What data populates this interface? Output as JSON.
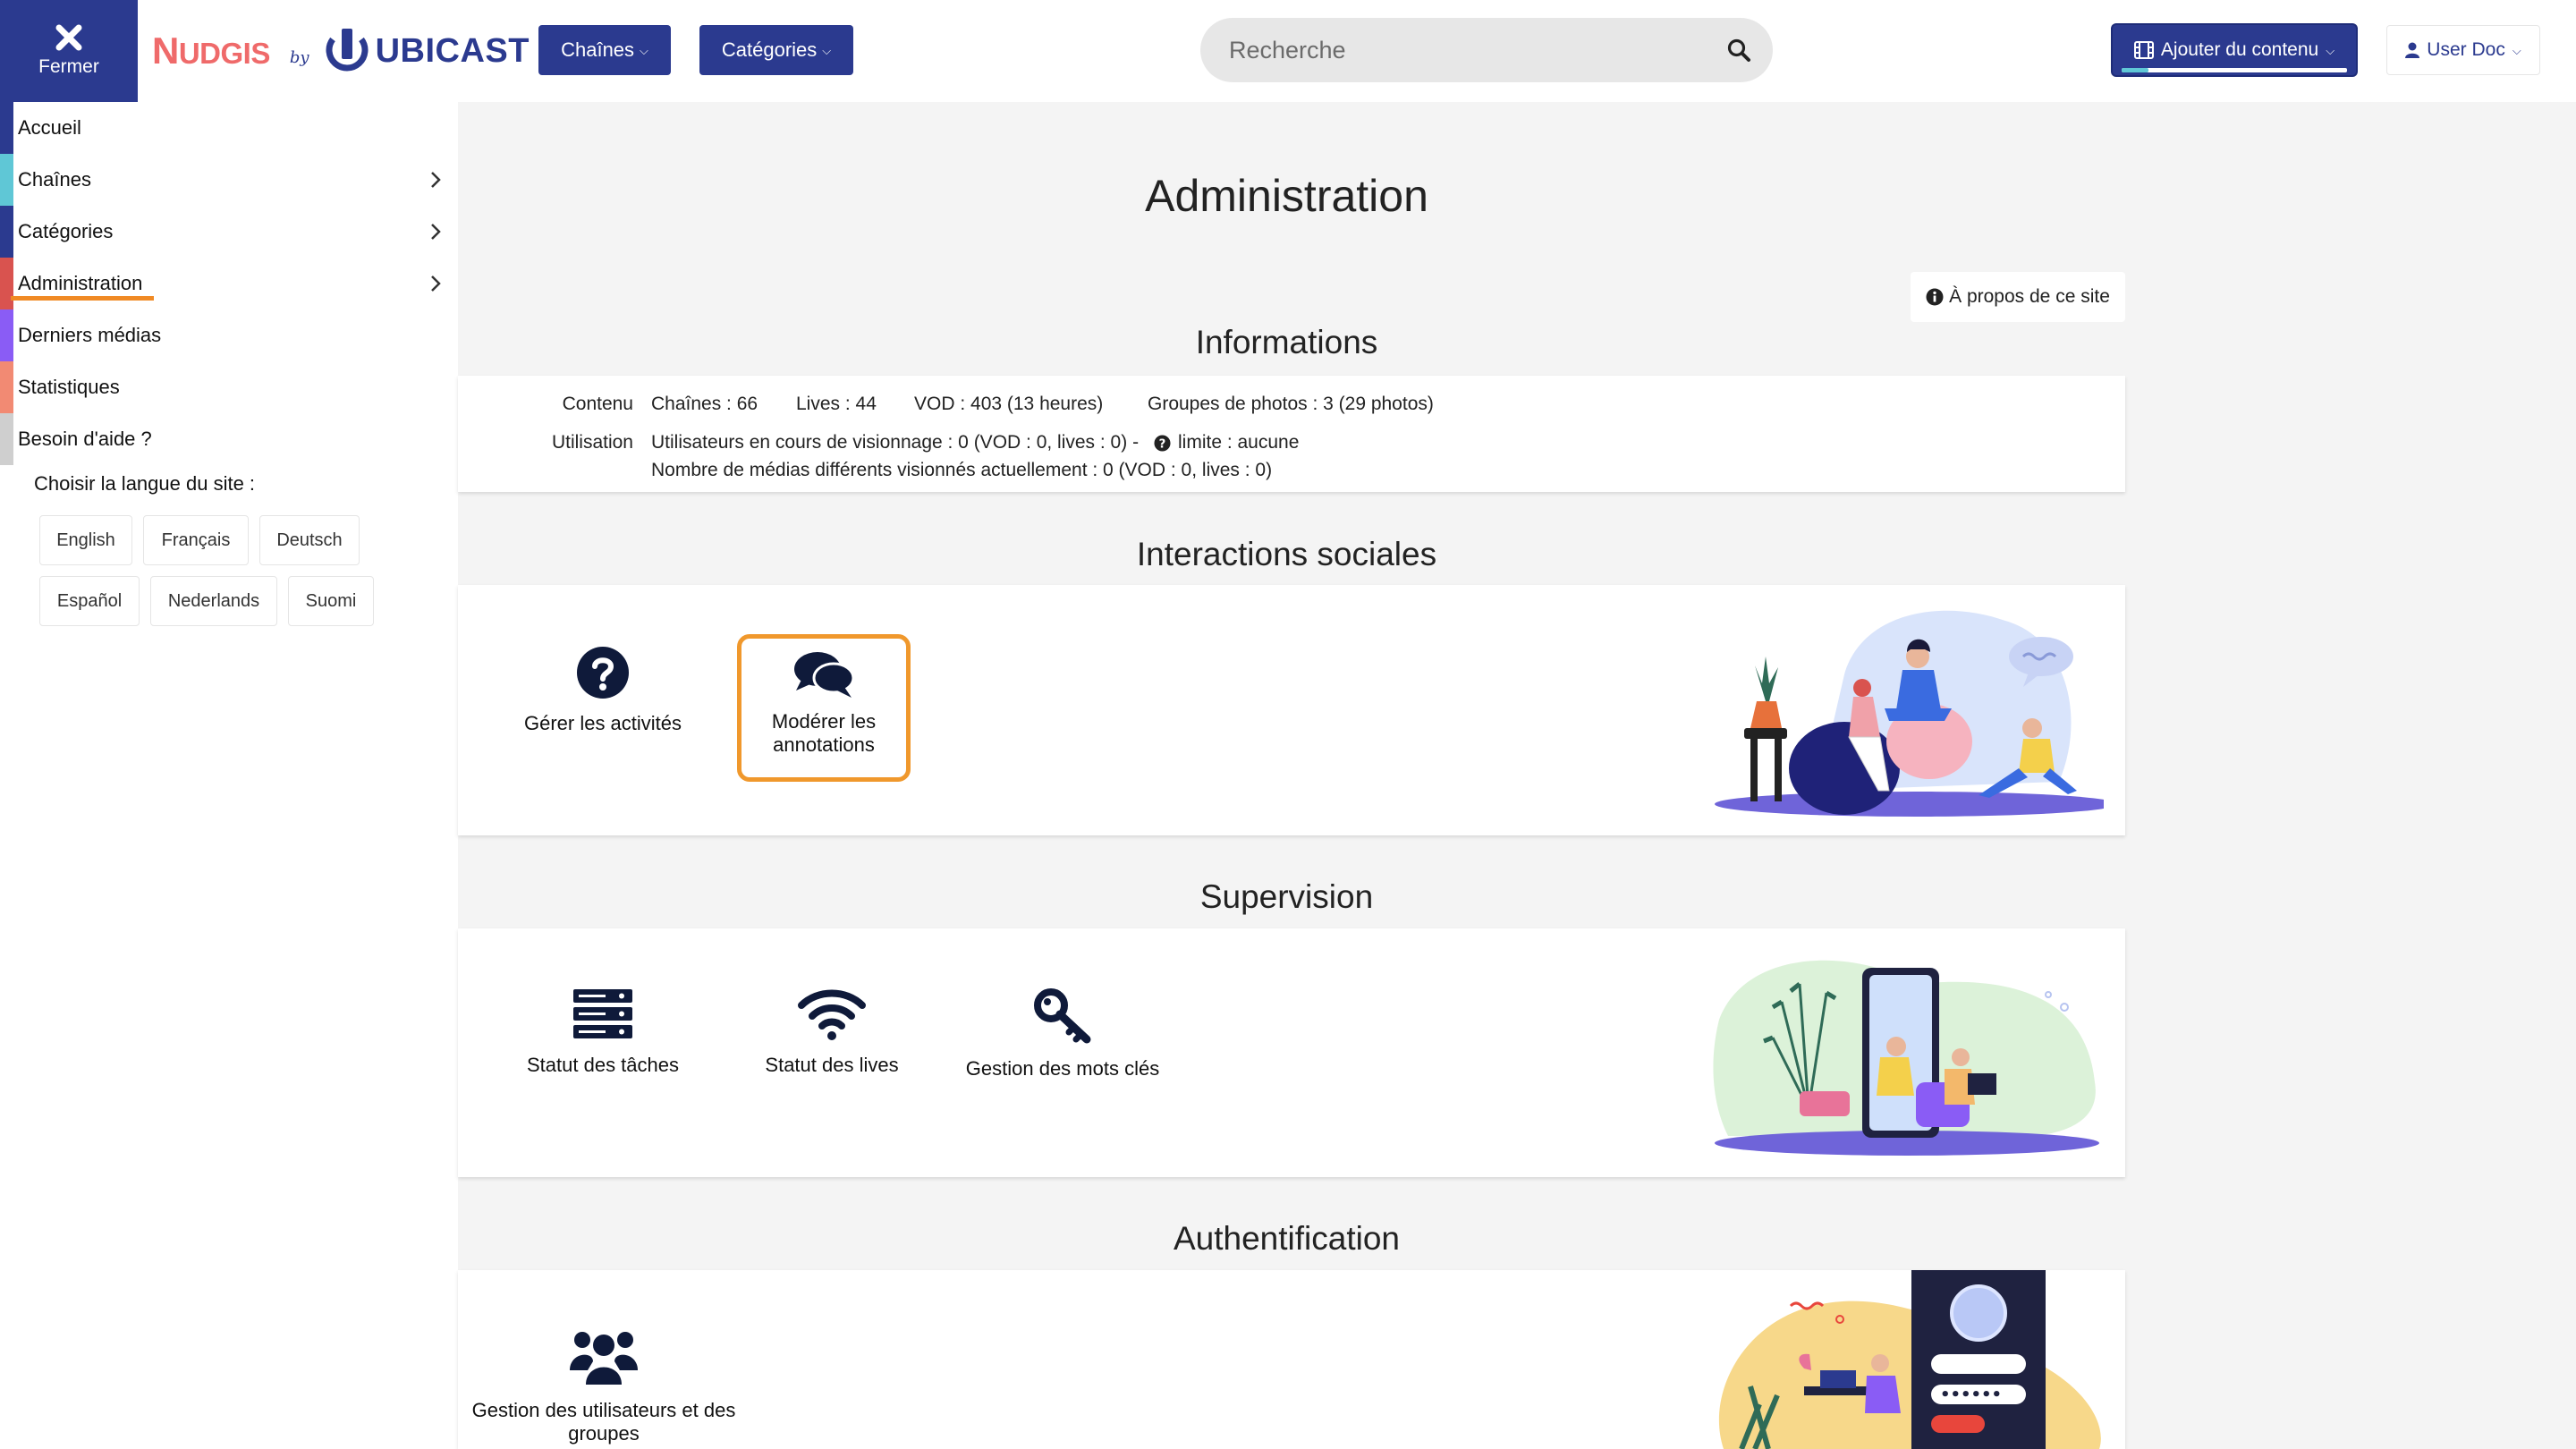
{
  "header": {
    "close_label": "Fermer",
    "logo": {
      "brand": "Nudgis",
      "by": "by",
      "partner": "UBICAST"
    },
    "nav": {
      "channels_label": "Chaînes",
      "categories_label": "Catégories"
    },
    "search": {
      "placeholder": "Recherche"
    },
    "add_content_label": "Ajouter du contenu",
    "user_label": "User Doc"
  },
  "sidebar": {
    "items": [
      {
        "label": "Accueil",
        "color": "#2b3a8f"
      },
      {
        "label": "Chaînes",
        "color": "#5fc7d6"
      },
      {
        "label": "Catégories",
        "color": "#2b3a8f"
      },
      {
        "label": "Administration",
        "color": "#d9534f"
      },
      {
        "label": "Derniers médias",
        "color": "#8a5cf5"
      },
      {
        "label": "Statistiques",
        "color": "#f28a73"
      },
      {
        "label": "Besoin d'aide ?",
        "color": "#cfcfcf"
      }
    ],
    "language_title": "Choisir la langue du site :",
    "languages": [
      "English",
      "Français",
      "Deutsch",
      "Español",
      "Nederlands",
      "Suomi"
    ]
  },
  "main": {
    "title": "Administration",
    "about_label": "À propos de ce site",
    "informations": {
      "title": "Informations",
      "content_label": "Contenu",
      "channels": "Chaînes : 66",
      "lives": "Lives : 44",
      "vod": "VOD : 403 (13 heures)",
      "photos": "Groupes de photos : 3 (29 photos)",
      "usage_label": "Utilisation",
      "usage_line1_prefix": "Utilisateurs en cours de visionnage : 0 (VOD : 0, lives : 0) -",
      "usage_line1_limit": "limite : aucune",
      "usage_line2": "Nombre de médias différents visionnés actuellement : 0 (VOD : 0, lives : 0)"
    },
    "social": {
      "title": "Interactions sociales",
      "tiles": [
        {
          "label": "Gérer les activités",
          "icon": "question-circle-icon"
        },
        {
          "label": "Modérer les annotations",
          "icon": "comments-icon"
        }
      ]
    },
    "supervision": {
      "title": "Supervision",
      "tiles": [
        {
          "label": "Statut des tâches",
          "icon": "server-icon"
        },
        {
          "label": "Statut des lives",
          "icon": "wifi-icon"
        },
        {
          "label": "Gestion des mots clés",
          "icon": "key-icon"
        }
      ]
    },
    "auth": {
      "title": "Authentification",
      "tiles": [
        {
          "label": "Gestion des utilisateurs et des groupes",
          "icon": "users-icon"
        }
      ]
    }
  },
  "colors": {
    "primary": "#2b3a8f",
    "accent_orange": "#f08a24",
    "brand_coral": "#ef6a6a",
    "background": "#f4f4f4"
  }
}
